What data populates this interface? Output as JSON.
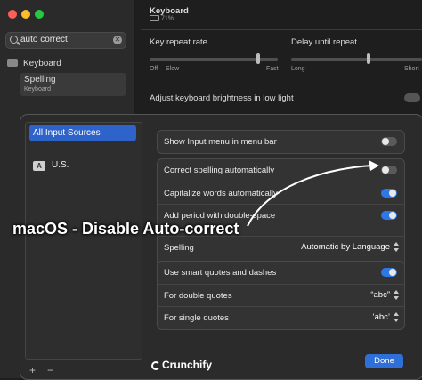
{
  "sidebar": {
    "search_value": "auto correct",
    "items": [
      {
        "label": "Keyboard"
      },
      {
        "label": "Spelling",
        "sublabel": "Keyboard"
      }
    ]
  },
  "main": {
    "title": "Keyboard",
    "battery": "71%",
    "key_repeat": {
      "label": "Key repeat rate",
      "ticks": [
        "Off",
        "Slow",
        "Fast"
      ]
    },
    "delay": {
      "label": "Delay until repeat",
      "ticks": [
        "Long",
        "Short"
      ]
    },
    "brightness_label": "Adjust keyboard brightness in low light"
  },
  "dialog": {
    "source_selected": "All Input Sources",
    "source_badge": "A",
    "source_us": "U.S.",
    "add_label": "+",
    "remove_label": "−",
    "rows": {
      "show_input_menu": {
        "label": "Show Input menu in menu bar",
        "on": false
      },
      "correct_spelling": {
        "label": "Correct spelling automatically",
        "on": false
      },
      "capitalize": {
        "label": "Capitalize words automatically",
        "on": true
      },
      "period": {
        "label": "Add period with double-space",
        "on": true
      },
      "spelling": {
        "label": "Spelling",
        "value": "Automatic by Language"
      },
      "smart_quotes": {
        "label": "Use smart quotes and dashes",
        "on": true
      },
      "double_quotes": {
        "label": "For double quotes",
        "value": "“abc”"
      },
      "single_quotes": {
        "label": "For single quotes",
        "value": "‘abc’"
      }
    },
    "done_label": "Done"
  },
  "overlay": {
    "title": "macOS - Disable Auto-correct",
    "logo": "Crunchify"
  },
  "colors": {
    "accent": "#2e6fd8",
    "selection": "#2e63c9"
  }
}
